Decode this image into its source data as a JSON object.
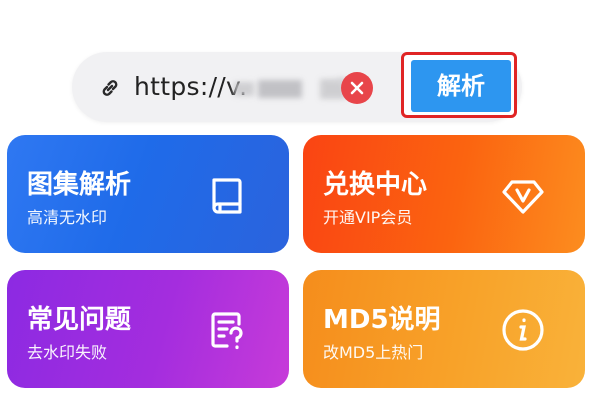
{
  "url_bar": {
    "icon": "link-icon",
    "url_text": "https://v.",
    "clear_icon": "close-icon",
    "parse_label": "解析"
  },
  "cards": [
    {
      "title": "图集解析",
      "subtitle": "高清无水印",
      "icon": "book-icon"
    },
    {
      "title": "兑换中心",
      "subtitle": "开通VIP会员",
      "icon": "vip-diamond-icon"
    },
    {
      "title": "常见问题",
      "subtitle": "去水印失败",
      "icon": "faq-document-icon"
    },
    {
      "title": "MD5说明",
      "subtitle": "改MD5上热门",
      "icon": "info-icon"
    }
  ],
  "colors": {
    "parse_button": "#2d96f0",
    "highlight_border": "#e02424",
    "clear_button": "#e8454a",
    "card_gallery": "#1f6be9",
    "card_vip": "#fb5a12",
    "card_faq": "#a42dde",
    "card_md5": "#f8a229"
  }
}
